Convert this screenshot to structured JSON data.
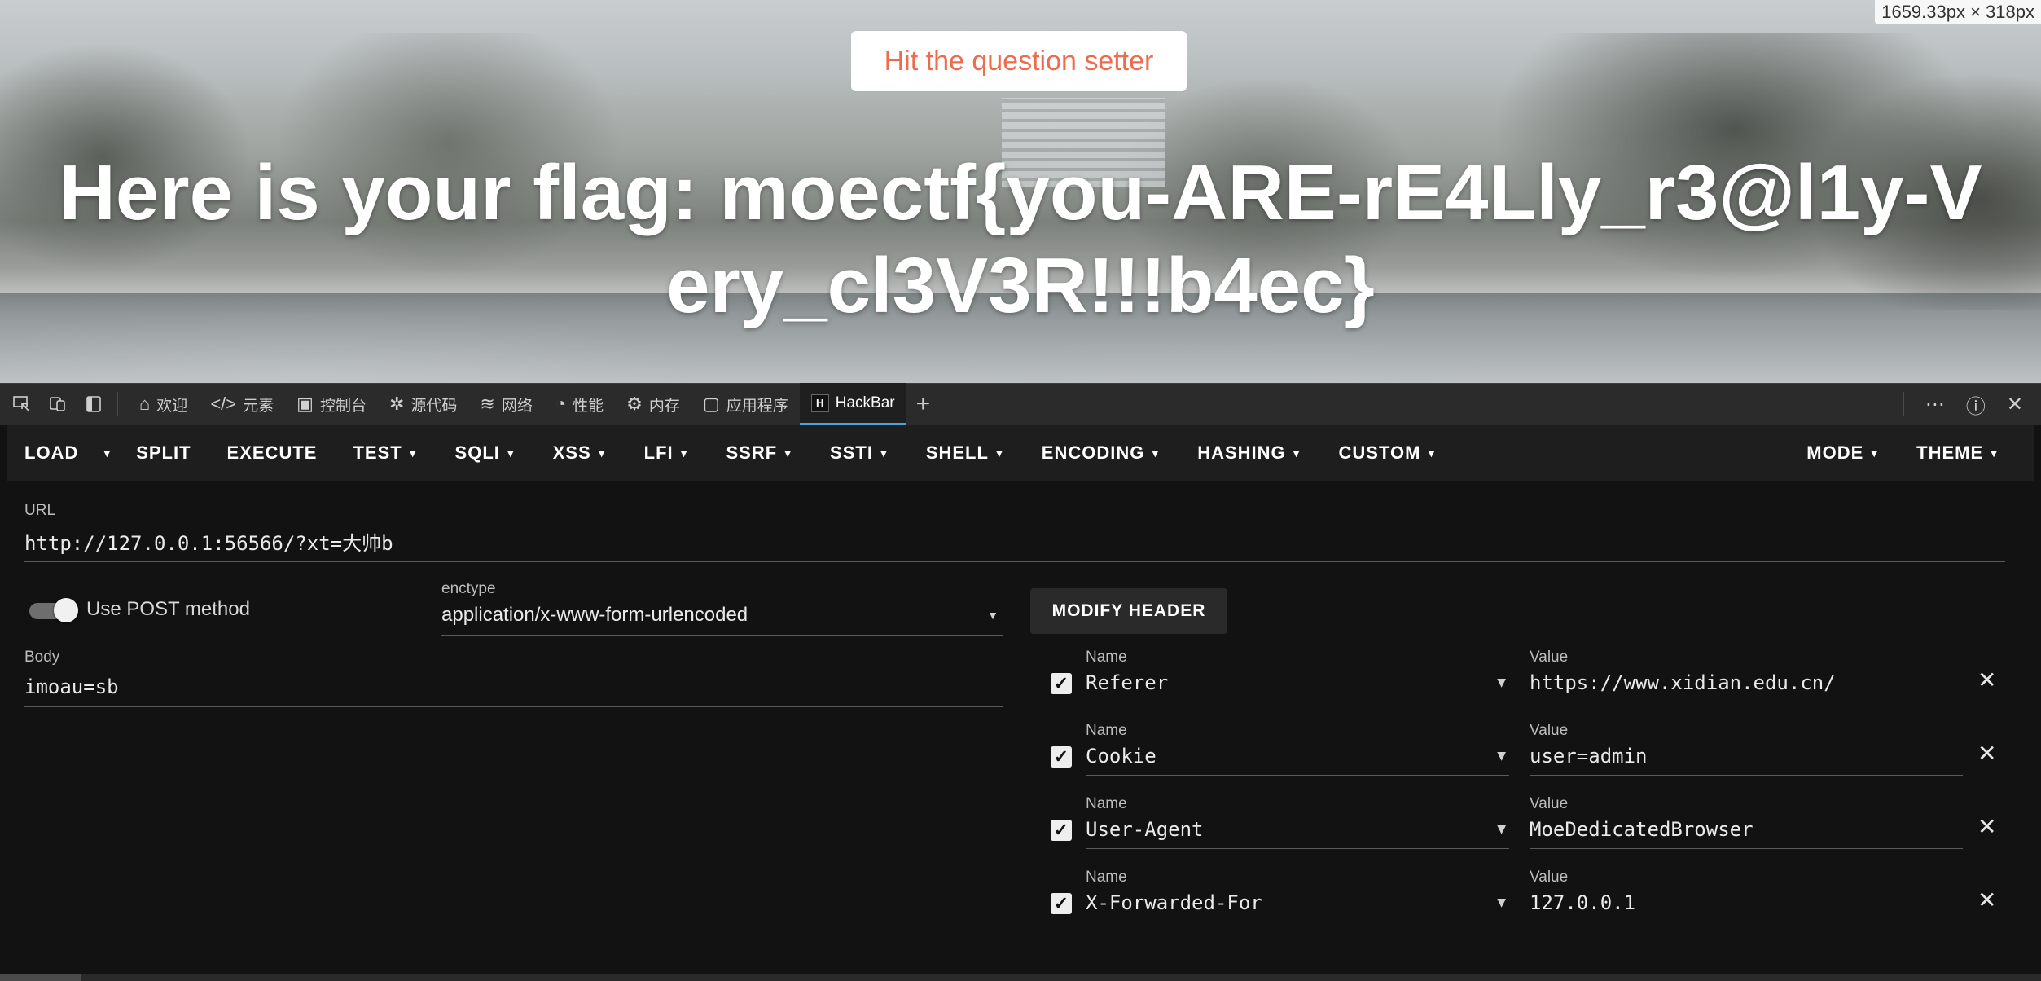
{
  "page": {
    "setter_button": "Hit the question setter",
    "flag_text": "Here is your flag: moectf{you-ARE-rE4Lly_r3@l1y-Very_cl3V3R!!!b4ec}",
    "dimension_badge": "1659.33px × 318px"
  },
  "devtools": {
    "tool_icons": [
      "inspect-icon",
      "device-emulation-icon",
      "dock-panel-icon"
    ],
    "tabs": [
      {
        "label": "欢迎",
        "icon": "home-icon"
      },
      {
        "label": "元素",
        "icon": "code-icon"
      },
      {
        "label": "控制台",
        "icon": "console-icon"
      },
      {
        "label": "源代码",
        "icon": "bug-icon"
      },
      {
        "label": "网络",
        "icon": "wifi-icon"
      },
      {
        "label": "性能",
        "icon": "gauge-icon"
      },
      {
        "label": "内存",
        "icon": "chip-icon"
      },
      {
        "label": "应用程序",
        "icon": "app-icon"
      },
      {
        "label": "HackBar",
        "icon": "hackbar-icon",
        "active": true
      }
    ],
    "right_icons": [
      "more-icon",
      "help-icon",
      "close-icon"
    ]
  },
  "hackbar": {
    "menu": {
      "load": "LOAD",
      "split": "SPLIT",
      "execute": "EXECUTE",
      "test": "TEST",
      "sqli": "SQLI",
      "xss": "XSS",
      "lfi": "LFI",
      "ssrf": "SSRF",
      "ssti": "SSTI",
      "shell": "SHELL",
      "encoding": "ENCODING",
      "hashing": "HASHING",
      "custom": "CUSTOM",
      "mode": "MODE",
      "theme": "THEME"
    },
    "url_label": "URL",
    "url_value": "http://127.0.0.1:56566/?xt=大帅b",
    "post_toggle_label": "Use POST method",
    "post_enabled": true,
    "enctype_label": "enctype",
    "enctype_value": "application/x-www-form-urlencoded",
    "body_label": "Body",
    "body_value": "imoau=sb",
    "modify_header_button": "MODIFY HEADER",
    "headers": [
      {
        "name_label": "Name",
        "name": "Referer",
        "value_label": "Value",
        "value": "https://www.xidian.edu.cn/",
        "checked": true
      },
      {
        "name_label": "Name",
        "name": "Cookie",
        "value_label": "Value",
        "value": "user=admin",
        "checked": true
      },
      {
        "name_label": "Name",
        "name": "User-Agent",
        "value_label": "Value",
        "value": "MoeDedicatedBrowser",
        "checked": true
      },
      {
        "name_label": "Name",
        "name": "X-Forwarded-For",
        "value_label": "Value",
        "value": "127.0.0.1",
        "checked": true
      }
    ]
  },
  "colors": {
    "setter_text": "#ee6c4d",
    "active_tab_accent": "#4aa3df",
    "panel_bg": "#121212"
  }
}
